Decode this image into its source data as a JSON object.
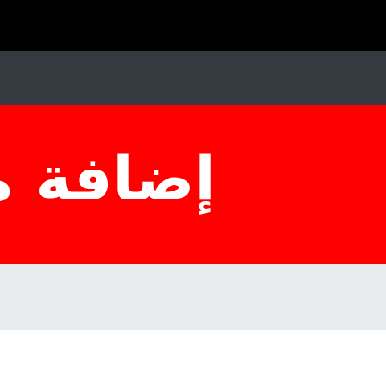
{
  "banner": {
    "title": "إضافة موضوع"
  },
  "colors": {
    "top_bar": "#000000",
    "nav_bar": "#343a40",
    "banner": "#ff0000",
    "banner_text": "#ffffff",
    "sub_bar": "#e9ecef",
    "page": "#ffffff"
  }
}
